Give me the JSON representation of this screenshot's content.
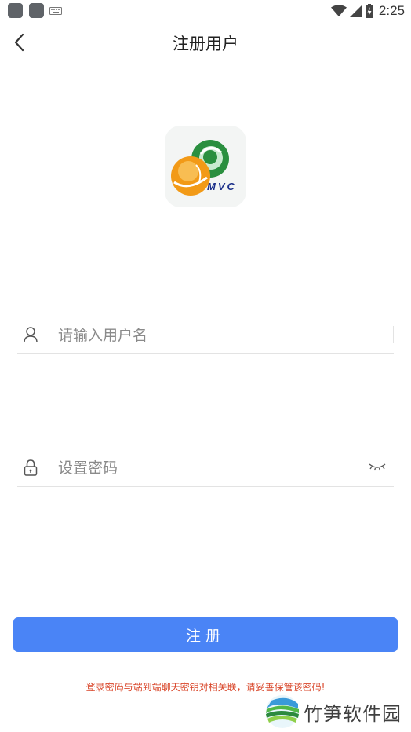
{
  "status_bar": {
    "time": "2:25"
  },
  "header": {
    "title": "注册用户"
  },
  "form": {
    "username_placeholder": "请输入用户名",
    "password_placeholder": "设置密码",
    "submit_label": "注册"
  },
  "logo": {
    "text": "MVC"
  },
  "notice": "登录密码与端到端聊天密钥对相关联，请妥善保管该密码!",
  "watermark": "竹笋软件园",
  "colors": {
    "accent": "#4a84f6",
    "notice": "#d9472b"
  }
}
